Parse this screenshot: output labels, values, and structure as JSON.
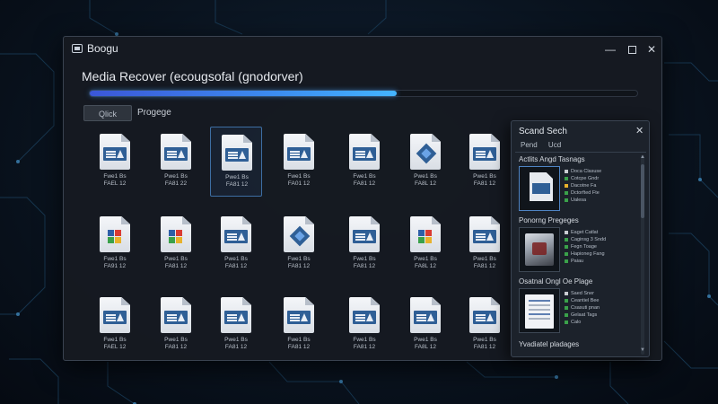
{
  "window": {
    "app_name": "Boogu",
    "minimize_glyph": "—",
    "close_glyph": "✕"
  },
  "main": {
    "heading": "Media Recover (ecougsofal (gnodorver)",
    "progress_fraction": 0.56,
    "tabs": [
      {
        "label": "Qlick"
      },
      {
        "label": "Progege"
      }
    ]
  },
  "grid": {
    "rows": [
      [
        {
          "icon": "doc",
          "label": "Fwe1 Bs\nFAEL 12"
        },
        {
          "icon": "doc",
          "label": "Pwe1 Bs\nFA81 22"
        },
        {
          "icon": "doc",
          "label": "Pwe1 Bs\nFA81 12",
          "selected": true
        },
        {
          "icon": "doc",
          "label": "Fwe1 Bs\nFA01 12"
        },
        {
          "icon": "doc",
          "label": "Fwe1 Bs\nFA81 12"
        },
        {
          "icon": "star",
          "label": "Pwe1 Bs\nFA8L 12"
        },
        {
          "icon": "doc",
          "label": "Pwe1 Bs\nFA81 12"
        }
      ],
      [
        {
          "icon": "mosaic",
          "label": "Fwe1 Bs\nFA91 12"
        },
        {
          "icon": "mosaic",
          "label": "Pwe1 Bs\nFA81 12"
        },
        {
          "icon": "doc",
          "label": "Pwe1 Bs\nFA81 12"
        },
        {
          "icon": "star",
          "label": "Fwe1 Bs\nFA81 12"
        },
        {
          "icon": "doc",
          "label": "Fwe1 Bs\nFA81 12"
        },
        {
          "icon": "mosaic",
          "label": "Pwe1 Bs\nFA8L 12"
        },
        {
          "icon": "doc",
          "label": "Pwe1 Bs\nFA81 12"
        }
      ],
      [
        {
          "icon": "doc",
          "label": "Fwe1 Bs\nFAEL 12"
        },
        {
          "icon": "doc",
          "label": "Pwe1 Bs\nFA81 12"
        },
        {
          "icon": "doc",
          "label": "Pwe1 Bs\nFA81 12"
        },
        {
          "icon": "doc",
          "label": "Fwe1 Bs\nFA81 12"
        },
        {
          "icon": "doc",
          "label": "Fwe1 Bs\nFA81 12"
        },
        {
          "icon": "doc",
          "label": "Pwe1 Bs\nFA8L 12"
        },
        {
          "icon": "doc",
          "label": "Pwe1 Bs\nFA81 12"
        }
      ]
    ]
  },
  "panel": {
    "title": "Scand Sech",
    "close_glyph": "✕",
    "tabs": [
      "Pend",
      "Ucd"
    ],
    "sections": [
      {
        "title": "Actlits Angd Tasnags",
        "thumb": "doc",
        "selected": true,
        "items": [
          {
            "color": "#c9ccd1",
            "text": "Doca Clasuse"
          },
          {
            "color": "#3aa14a",
            "text": "Cotcpe Gndr"
          },
          {
            "color": "#e8b22c",
            "text": "Dacotne Fa"
          },
          {
            "color": "#3aa14a",
            "text": "Dctorfted Fte"
          },
          {
            "color": "#3aa14a",
            "text": "Ualesa"
          }
        ]
      },
      {
        "title": "Ponorng Pregeges",
        "thumb": "photo",
        "selected": false,
        "items": [
          {
            "color": "#c9ccd1",
            "text": "Eaget Catlat"
          },
          {
            "color": "#3aa14a",
            "text": "Caginsg 3 Sndd"
          },
          {
            "color": "#3aa14a",
            "text": "Fegn Toage"
          },
          {
            "color": "#3aa14a",
            "text": "Hapioneg Fang"
          },
          {
            "color": "#3aa14a",
            "text": "Paiau"
          }
        ]
      },
      {
        "title": "Osatnal Ongl Oe Plage",
        "thumb": "screenshot",
        "selected": false,
        "items": [
          {
            "color": "#c9ccd1",
            "text": "Saed Sner"
          },
          {
            "color": "#3aa14a",
            "text": "Ceantiel Bee"
          },
          {
            "color": "#3aa14a",
            "text": "Csasuti pnan"
          },
          {
            "color": "#3aa14a",
            "text": "Gelaat Tags"
          },
          {
            "color": "#3aa14a",
            "text": "Calo"
          }
        ]
      }
    ],
    "footer_label": "Yvadiatel pladages"
  }
}
